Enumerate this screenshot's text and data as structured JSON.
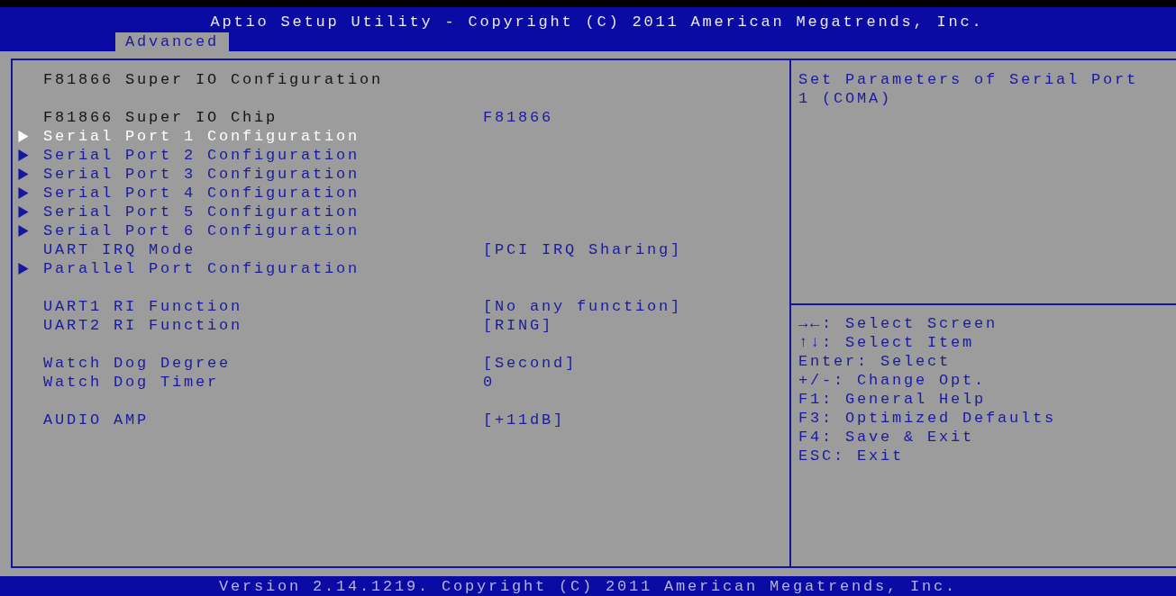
{
  "window": {
    "title": "Aptio Setup Utility - Copyright (C) 2011 American Megatrends, Inc."
  },
  "tabs": [
    {
      "label": "Advanced",
      "selected": true
    }
  ],
  "groups": [
    {
      "items": [
        {
          "kind": "heading",
          "label": "F81866 Super IO Configuration"
        }
      ]
    },
    {
      "items": [
        {
          "kind": "info",
          "label": "F81866 Super IO Chip",
          "value": "F81866"
        },
        {
          "kind": "submenu",
          "label": "Serial Port 1 Configuration",
          "selected": true
        },
        {
          "kind": "submenu",
          "label": "Serial Port 2 Configuration",
          "selected": false
        },
        {
          "kind": "submenu",
          "label": "Serial Port 3 Configuration",
          "selected": false
        },
        {
          "kind": "submenu",
          "label": "Serial Port 4 Configuration",
          "selected": false
        },
        {
          "kind": "submenu",
          "label": "Serial Port 5 Configuration",
          "selected": false
        },
        {
          "kind": "submenu",
          "label": "Serial Port 6 Configuration",
          "selected": false
        },
        {
          "kind": "setting",
          "label": "UART IRQ Mode",
          "value": "[PCI IRQ Sharing]"
        },
        {
          "kind": "submenu",
          "label": "Parallel Port Configuration",
          "selected": false
        }
      ]
    },
    {
      "items": [
        {
          "kind": "setting",
          "label": "UART1 RI Function",
          "value": "[No any function]"
        },
        {
          "kind": "setting",
          "label": "UART2 RI Function",
          "value": "[RING]"
        }
      ]
    },
    {
      "items": [
        {
          "kind": "setting",
          "label": "Watch Dog Degree",
          "value": "[Second]"
        },
        {
          "kind": "setting",
          "label": "Watch Dog Timer",
          "value": "0"
        }
      ]
    },
    {
      "items": [
        {
          "kind": "setting",
          "label": "AUDIO AMP",
          "value": "[+11dB]"
        }
      ]
    }
  ],
  "help": {
    "text": "Set Parameters of Serial Port 1 (COMA)"
  },
  "keys": [
    "→←: Select Screen",
    "↑↓: Select Item",
    "Enter: Select",
    "+/-: Change Opt.",
    "F1: General Help",
    "F3: Optimized Defaults",
    "F4: Save & Exit",
    "ESC: Exit"
  ],
  "status_bar": "Version 2.14.1219. Copyright (C) 2011 American Megatrends, Inc."
}
